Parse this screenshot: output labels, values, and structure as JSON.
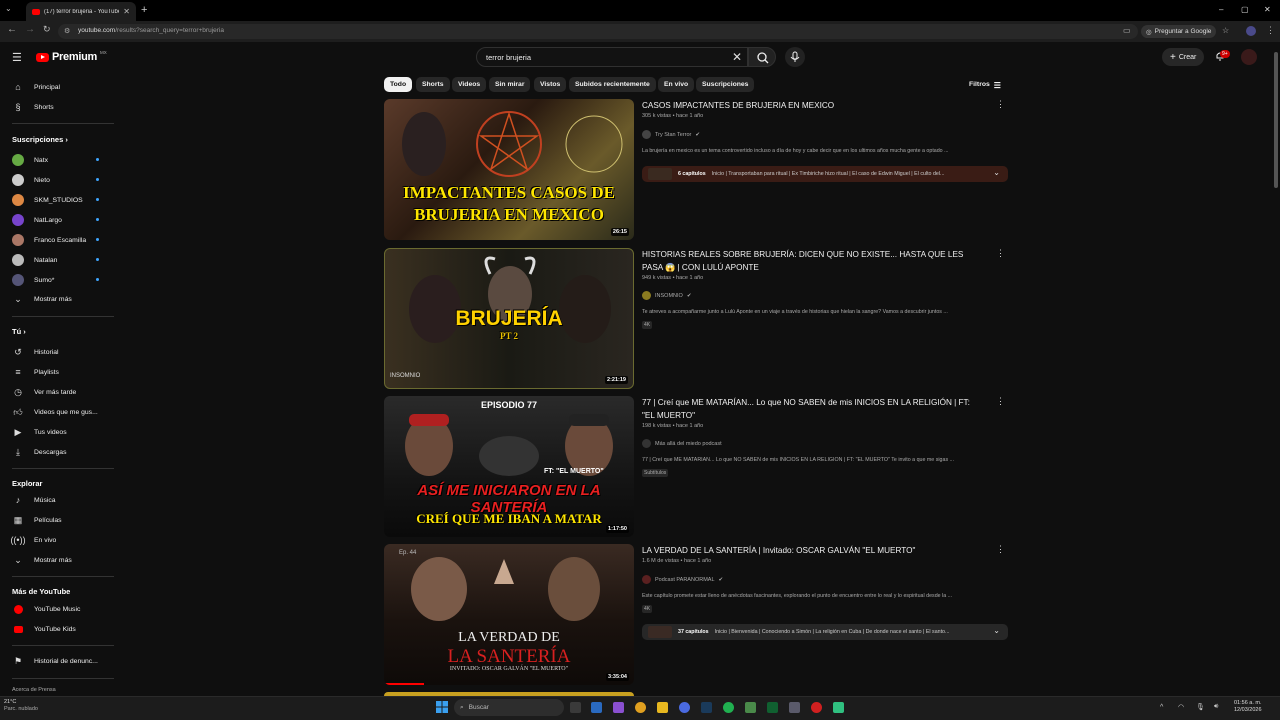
{
  "browser": {
    "tab_title": "(17) terror brujeria - YouTube",
    "url_host": "youtube.com",
    "url_path": "/results?search_query=terror+brujeria",
    "ask_google": "Preguntar a Google"
  },
  "header": {
    "logo": "Premium",
    "region": "MX",
    "search_value": "terror brujeria",
    "create": "Crear",
    "notif_badge": "9+"
  },
  "sidebar": {
    "top": [
      {
        "label": "Principal",
        "icon": "home-icon"
      },
      {
        "label": "Shorts",
        "icon": "shorts-icon"
      }
    ],
    "subs_header": "Suscripciones",
    "subs": [
      {
        "label": "Natx",
        "color": "#6a4"
      },
      {
        "label": "Nieto",
        "color": "#ccc"
      },
      {
        "label": "SKM_STUDIOS",
        "color": "#d84"
      },
      {
        "label": "NatLargo",
        "color": "#74c"
      },
      {
        "label": "Franco Escamilla",
        "color": "#a76"
      },
      {
        "label": "Natalan",
        "color": "#bbb"
      },
      {
        "label": "Sumo*",
        "color": "#557"
      }
    ],
    "more": "Mostrar más",
    "you_header": "Tú",
    "you": [
      {
        "label": "Historial",
        "icon": "history-icon"
      },
      {
        "label": "Playlists",
        "icon": "playlist-icon"
      },
      {
        "label": "Ver más tarde",
        "icon": "clock-icon"
      },
      {
        "label": "Videos que me gus...",
        "icon": "thumb-up-icon"
      },
      {
        "label": "Tus videos",
        "icon": "video-icon"
      },
      {
        "label": "Descargas",
        "icon": "download-icon"
      }
    ],
    "explore_header": "Explorar",
    "explore": [
      {
        "label": "Música",
        "icon": "music-icon"
      },
      {
        "label": "Películas",
        "icon": "film-icon"
      },
      {
        "label": "En vivo",
        "icon": "live-icon"
      },
      {
        "label": "Mostrar más",
        "icon": "chevron-down-icon"
      }
    ],
    "more_yt_header": "Más de YouTube",
    "more_yt": [
      {
        "label": "YouTube Music"
      },
      {
        "label": "YouTube Kids"
      }
    ],
    "report": "Historial de denunc...",
    "footer": "Acerca de  Prensa"
  },
  "chips": [
    "Todo",
    "Shorts",
    "Videos",
    "Sin mirar",
    "Vistos",
    "Subidos recientemente",
    "En vivo",
    "Suscripciones"
  ],
  "filters": "Filtros",
  "results": [
    {
      "title": "CASOS IMPACTANTES DE BRUJERIA EN MEXICO",
      "meta": "305 k vistas • hace 1 año",
      "channel": "Try Stan Terror",
      "desc": "La brujería en mexico es un tema controvertido incluso a día de hoy y cabe decir que en los ultimos años mucha gente a optado ...",
      "duration": "26:15",
      "thumb_text": [
        "IMPACTANTES CASOS DE",
        "BRUJERIA EN MEXICO"
      ],
      "chapters_count": "6 capítulos",
      "chapters": "Inicio | Transportaban para ritual | Ex Timbiriche hizo ritual | El caso de Edwin Miguel | El culto del..."
    },
    {
      "title": "HISTORIAS REALES SOBRE BRUJERÍA: DICEN QUE NO EXISTE... HASTA QUE LES PASA 😱 | CON LULÚ APONTE",
      "meta": "949 k vistas • hace 1 año",
      "channel": "INSOMNIO",
      "desc": "Te atreves a acompañarme junto a Lulú Aponte en un viaje a través de historias que hielan la sangre? Vamos a descubrir juntos ...",
      "badge": "4K",
      "duration": "2:21:19",
      "thumb_text": [
        "BRUJERÍA",
        "PT 2"
      ],
      "thumb_corner": "INSOMNIO"
    },
    {
      "title": "77 | Creí que ME MATARÍAN... Lo que NO SABEN de mis INICIOS EN LA RELIGIÓN | FT: \"EL MUERTO\"",
      "meta": "198 k vistas • hace 1 año",
      "channel": "Más allá del miedo podcast",
      "desc": "77 | Creí que ME MATARÍAN... Lo que NO SABEN de mis INICIOS EN LA RELIGIÓN | FT: \"EL MUERTO\" Te invito a que me sigas ...",
      "badge": "Subtítulos",
      "duration": "1:17:50",
      "thumb_text": [
        "EPISODIO 77",
        "ASÍ ME INICIARON EN LA SANTERÍA",
        "CREÍ QUE ME IBAN A MATAR",
        "FT: \"EL MUERTO\""
      ]
    },
    {
      "title": "LA VERDAD DE LA SANTERÍA | Invitado: OSCAR GALVÁN \"EL MUERTO\"",
      "meta": "1.6 M de vistas • hace 1 año",
      "channel": "Podcast PARANORMAL",
      "desc": "Este capítulo promete estar lleno de anécdotas fascinantes, explorando el punto de encuentro entre lo real y lo espiritual desde la ...",
      "badge": "4K",
      "duration": "3:35:04",
      "thumb_text": [
        "LA VERDAD DE",
        "LA SANTERÍA",
        "INVITADO: OSCAR GALVÁN \"EL MUERTO\"",
        "Ep. 44"
      ],
      "chapters_count": "37 capítulos",
      "chapters": "Inicio | Bienvenida | Conociendo a Simón | La religión en Cuba | De donde nace el santo | El santo..."
    }
  ],
  "taskbar": {
    "weather_temp": "21°C",
    "weather_desc": "Parc. nublado",
    "search": "Buscar",
    "time": "01:56 a. m.",
    "date": "12/03/2026"
  }
}
